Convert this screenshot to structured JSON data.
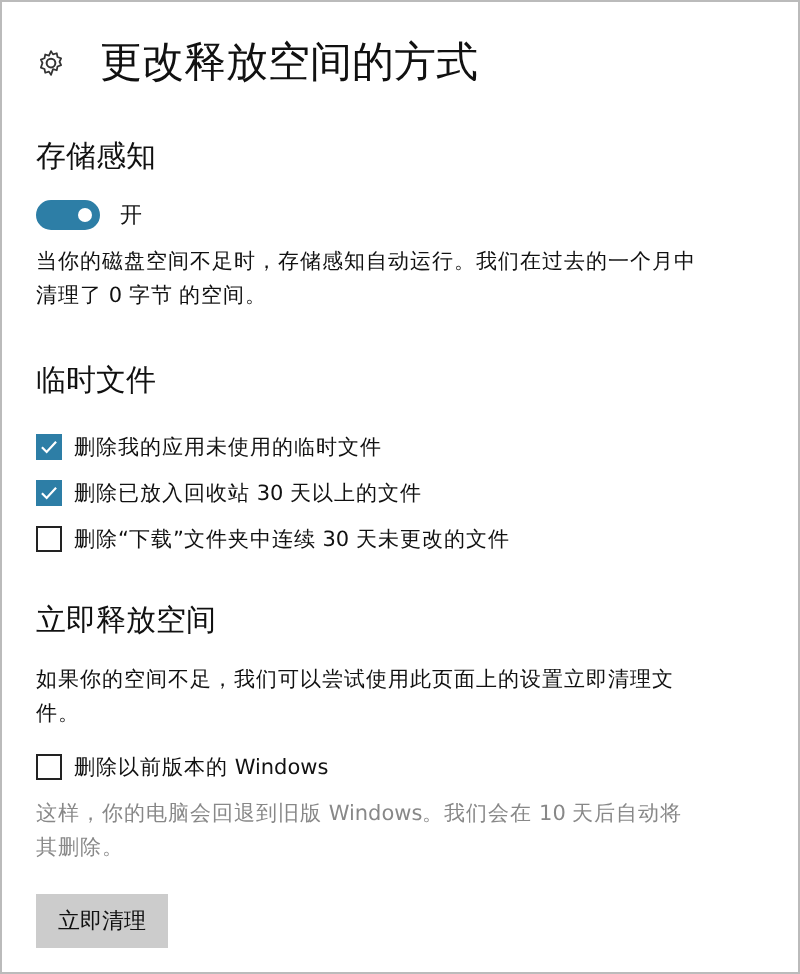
{
  "page": {
    "title": "更改释放空间的方式"
  },
  "storage_sense": {
    "heading": "存储感知",
    "toggle": {
      "on": true,
      "label": "开"
    },
    "description": "当你的磁盘空间不足时，存储感知自动运行。我们在过去的一个月中清理了 0 字节 的空间。"
  },
  "temp_files": {
    "heading": "临时文件",
    "options": [
      {
        "label": "删除我的应用未使用的临时文件",
        "checked": true
      },
      {
        "label": "删除已放入回收站 30 天以上的文件",
        "checked": true
      },
      {
        "label": "删除“下载”文件夹中连续 30 天未更改的文件",
        "checked": false
      }
    ]
  },
  "free_up_now": {
    "heading": "立即释放空间",
    "description": "如果你的空间不足，我们可以尝试使用此页面上的设置立即清理文件。",
    "option": {
      "label": "删除以前版本的 Windows",
      "checked": false
    },
    "note": "这样，你的电脑会回退到旧版 Windows。我们会在 10 天后自动将其删除。",
    "button": "立即清理"
  }
}
